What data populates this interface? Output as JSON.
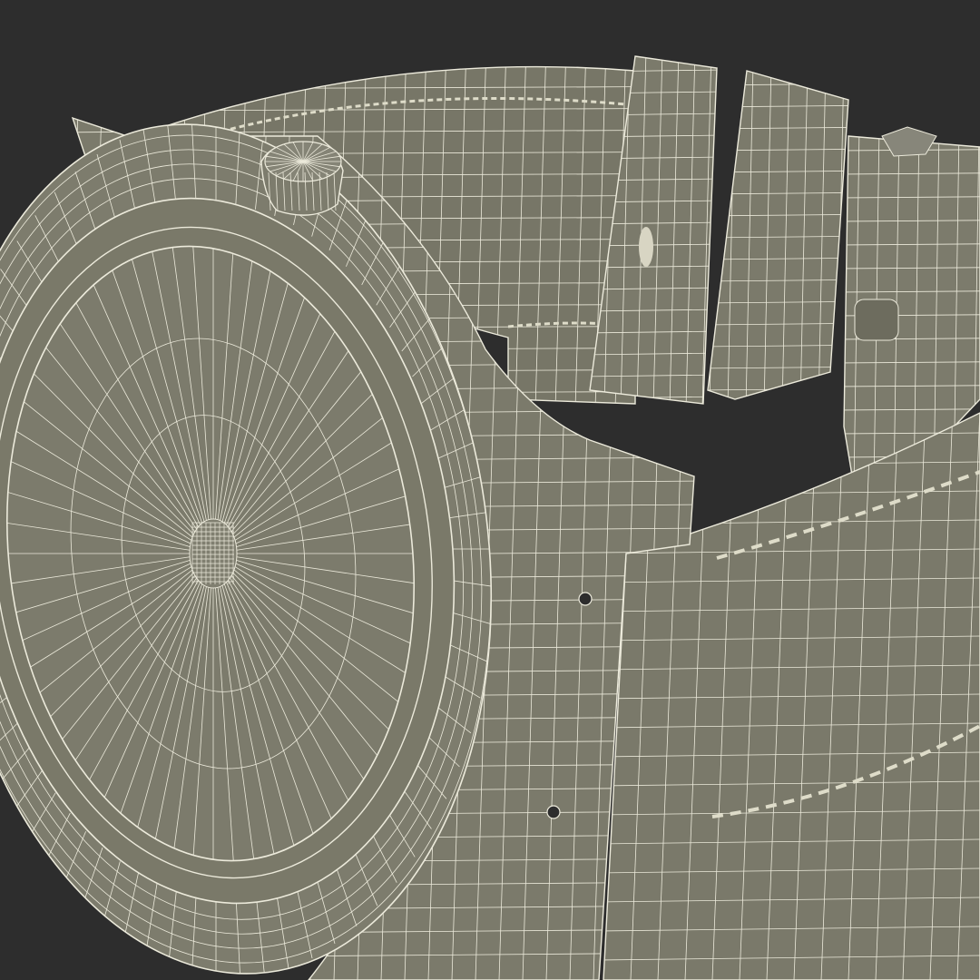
{
  "scene": {
    "subject": "wristwatch-wireframe-model",
    "colors": {
      "background": "#2d2d2d",
      "surface": "#787769",
      "surface_light": "#858476",
      "surface_dark": "#5f5e53",
      "wire": "#eceadb",
      "shadow": "#1f1f1f"
    }
  }
}
